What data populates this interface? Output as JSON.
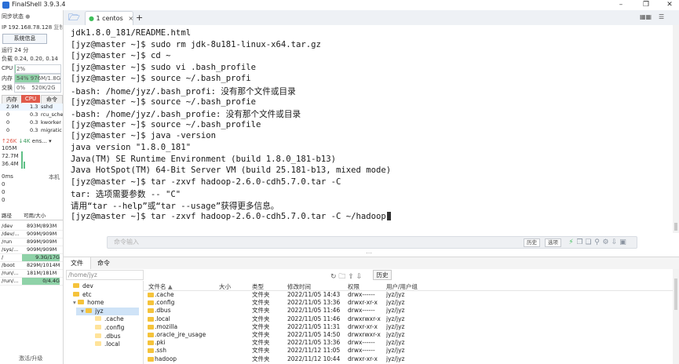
{
  "window": {
    "title": "FinalShell 3.9.3.4"
  },
  "left": {
    "sync_status": "同步状态",
    "ip": "IP 192.168.78.128",
    "copy_label": "复制",
    "sys_info_button": "系统信息",
    "uptime": "运行 24 分",
    "load": "负载 0.24, 0.20, 0.14",
    "cpu": {
      "label": "CPU",
      "value": "2%",
      "fraction": 0.02
    },
    "mem": {
      "label": "内存",
      "percent": "54%",
      "value": "976M/1.8G",
      "fraction": 0.54
    },
    "swap": {
      "label": "交换",
      "percent": "0%",
      "value": "520K/2G",
      "fraction": 0.0
    },
    "proc_tabs": [
      "内存",
      "CPU",
      "命令"
    ],
    "processes": [
      {
        "mem": "2.9M",
        "cpu": "1.3",
        "cmd": "sshd"
      },
      {
        "mem": "0",
        "cpu": "0.3",
        "cmd": "rcu_sche"
      },
      {
        "mem": "0",
        "cpu": "0.3",
        "cmd": "kworker"
      },
      {
        "mem": "0",
        "cpu": "0.3",
        "cmd": "migratic"
      }
    ],
    "net": {
      "up": "↑26K",
      "down": "↓4K",
      "iface": "ens..."
    },
    "net_scale": [
      "105M",
      "72.7M",
      "36.4M"
    ],
    "ping": {
      "value": "0ms",
      "host": "本机",
      "rows": [
        "0",
        "0",
        "0"
      ]
    },
    "disk_header": {
      "path": "路径",
      "size": "可用/大小"
    },
    "disks": [
      {
        "path": "/dev",
        "size": "893M/893M"
      },
      {
        "path": "/dev/...",
        "size": "909M/909M"
      },
      {
        "path": "/run",
        "size": "899M/909M"
      },
      {
        "path": "/sys/...",
        "size": "909M/909M"
      },
      {
        "path": "/",
        "size": "9.3G/17G"
      },
      {
        "path": "/boot",
        "size": "829M/1014M"
      },
      {
        "path": "/run/...",
        "size": "181M/181M"
      },
      {
        "path": "/run/...",
        "size": "0/4.4G"
      }
    ],
    "activate": "激活/升级"
  },
  "tabs": {
    "active": "1 centos",
    "add": "+"
  },
  "terminal": {
    "lines": [
      "jdk1.8.0_181/README.html",
      "[jyz@master ~]$ sudo rm jdk-8u181-linux-x64.tar.gz",
      "[jyz@master ~]$ cd ~",
      "[jyz@master ~]$ sudo vi .bash_profile",
      "[jyz@master ~]$ source ~/.bash_profi",
      "-bash: /home/jyz/.bash_profi: 没有那个文件或目录",
      "[jyz@master ~]$ source ~/.bash_profie",
      "-bash: /home/jyz/.bash_profie: 没有那个文件或目录",
      "[jyz@master ~]$ source ~/.bash_profile",
      "[jyz@master ~]$ java -version",
      "java version \"1.8.0_181\"",
      "Java(TM) SE Runtime Environment (build 1.8.0_181-b13)",
      "Java HotSpot(TM) 64-Bit Server VM (build 25.181-b13, mixed mode)",
      "[jyz@master ~]$ tar -zxvf hadoop-2.6.0-cdh5.7.0.tar -C",
      "tar: 选项需要参数 -- \"C\"",
      "请用“tar --help”或“tar --usage”获得更多信息。",
      "[jyz@master ~]$ tar -zxvf hadoop-2.6.0-cdh5.7.0.tar -C ~/hadoop"
    ]
  },
  "cmdbar": {
    "placeholder": "命令输入",
    "history": "历史",
    "options": "选项"
  },
  "bottom": {
    "tabs": [
      "文件",
      "命令"
    ],
    "path": "/home/jyz",
    "history": "历史",
    "tree": [
      {
        "name": "dev",
        "level": 1
      },
      {
        "name": "etc",
        "level": 1
      },
      {
        "name": "home",
        "level": 1
      },
      {
        "name": "jyz",
        "level": 2
      },
      {
        "name": ".cache",
        "level": 3
      },
      {
        "name": ".config",
        "level": 3
      },
      {
        "name": ".dbus",
        "level": 3
      },
      {
        "name": ".local",
        "level": 3
      }
    ],
    "columns": {
      "name": "文件名",
      "size": "大小",
      "type": "类型",
      "mtime": "修改时间",
      "perm": "权限",
      "owner": "用户/用户组"
    },
    "files": [
      {
        "name": ".cache",
        "type": "文件夹",
        "mtime": "2022/11/05 14:43",
        "perm": "drwx------",
        "owner": "jyz/jyz"
      },
      {
        "name": ".config",
        "type": "文件夹",
        "mtime": "2022/11/05 13:36",
        "perm": "drwxr-xr-x",
        "owner": "jyz/jyz"
      },
      {
        "name": ".dbus",
        "type": "文件夹",
        "mtime": "2022/11/05 11:46",
        "perm": "drwx------",
        "owner": "jyz/jyz"
      },
      {
        "name": ".local",
        "type": "文件夹",
        "mtime": "2022/11/05 11:46",
        "perm": "drwxrwxr-x",
        "owner": "jyz/jyz"
      },
      {
        "name": ".mozilla",
        "type": "文件夹",
        "mtime": "2022/11/05 11:31",
        "perm": "drwxr-xr-x",
        "owner": "jyz/jyz"
      },
      {
        "name": ".oracle_jre_usage",
        "type": "文件夹",
        "mtime": "2022/11/05 14:50",
        "perm": "drwxrwxr-x",
        "owner": "jyz/jyz"
      },
      {
        "name": ".pki",
        "type": "文件夹",
        "mtime": "2022/11/05 13:36",
        "perm": "drwx------",
        "owner": "jyz/jyz"
      },
      {
        "name": ".ssh",
        "type": "文件夹",
        "mtime": "2022/11/12 11:05",
        "perm": "drwx------",
        "owner": "jyz/jyz"
      },
      {
        "name": "hadoop",
        "type": "文件夹",
        "mtime": "2022/11/12 10:44",
        "perm": "drwxr-xr-x",
        "owner": "jyz/jyz"
      }
    ]
  },
  "colors": {
    "accent": "#2b6fd6",
    "metric_fill": "#8fd2a8",
    "proc_tab_active": "#e05a4b",
    "folder": "#f5c33b"
  }
}
